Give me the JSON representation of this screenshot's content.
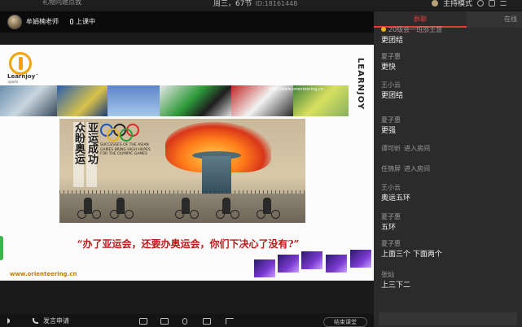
{
  "topbar": {
    "left_text": "礼物问题点我",
    "center_title": "周三，67节",
    "center_id": "ID:18161448",
    "mode_label": "主持模式"
  },
  "teacher": {
    "name": "牟娟楠老师",
    "status": "上课中"
  },
  "slide": {
    "logo_text": "Learnjoy",
    "logo_tm": "™",
    "logo_sub": "sports",
    "vertical_brand": "LEARNJOY",
    "photo_url_small": "http://www.orienteering.cn",
    "chinese_cols": [
      "亚运成功",
      "众盼奥运"
    ],
    "success_text": "SUCCESSES OF THE ASIAN GAMES BRING HIGH HOPES FOR THE OLYMPIC GAMES",
    "quote": "“办了亚运会，还要办奥运会，你们下决心了没有?”",
    "url": "www.orienteering.cn"
  },
  "bottombar": {
    "apply_label": "发言申请",
    "end_class_label": "结束课堂"
  },
  "chat": {
    "tabs": [
      {
        "label": "群聊",
        "active": true
      },
      {
        "label": "在线",
        "active": false
      }
    ],
    "messages": [
      {
        "sender": "20级会一班邵王慧",
        "text": "更团结",
        "system": false
      },
      {
        "sender": "夏子惠",
        "text": "更快",
        "system": false
      },
      {
        "sender": "王小云",
        "text": "更团结",
        "system": false
      },
      {
        "sender": "夏子惠",
        "text": "更强",
        "system": false
      },
      {
        "sender": "谭可昕",
        "text": "进入房间",
        "system": true
      },
      {
        "sender": "任锦屏",
        "text": "进入房间",
        "system": true
      },
      {
        "sender": "王小云",
        "text": "奥运五环",
        "system": false
      },
      {
        "sender": "夏子惠",
        "text": "五环",
        "system": false
      },
      {
        "sender": "夏子惠",
        "text": "上面三个 下面两个",
        "system": false
      },
      {
        "sender": "张灿",
        "text": "上三下二",
        "system": false
      }
    ]
  },
  "colors": {
    "accent_red": "#e03e3e",
    "quote_red": "#c01818",
    "logo_orange": "#f2a20a"
  }
}
